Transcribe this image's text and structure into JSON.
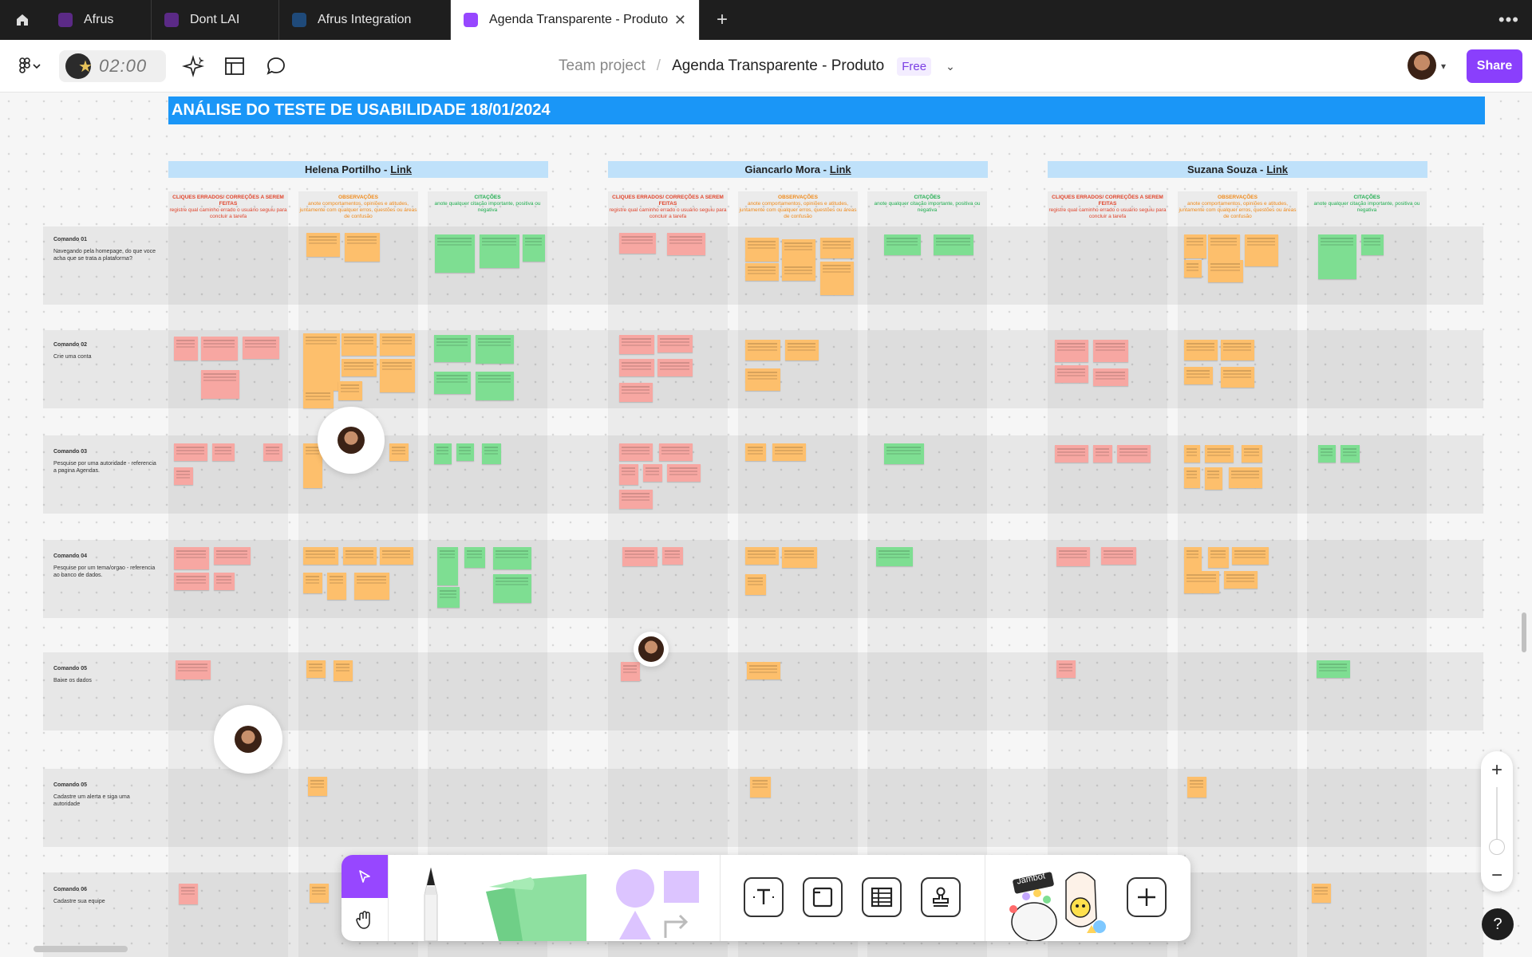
{
  "browser": {
    "tabs": [
      {
        "label": "Afrus"
      },
      {
        "label": "Dont LAI"
      },
      {
        "label": "Afrus Integration"
      },
      {
        "label": "Agenda Transparente - Produto",
        "active": true
      }
    ]
  },
  "toolbar": {
    "timer": "02:00",
    "breadcrumb_team": "Team project",
    "breadcrumb_file": "Agenda Transparente - Produto",
    "plan_badge": "Free",
    "share_label": "Share"
  },
  "board": {
    "banner": "ANÁLISE DO TESTE DE USABILIDADE 18/01/2024",
    "participants": [
      {
        "name": "Helena Portilho -",
        "link": "Link"
      },
      {
        "name": "Giancarlo Mora -",
        "link": "Link"
      },
      {
        "name": "Suzana Souza -",
        "link": "Link"
      }
    ],
    "column_headers": [
      {
        "title": "CLIQUES ERRADOS/ CORREÇÕES A SEREM FEITAS",
        "desc": "registre qual caminho errado o usuário seguiu para concluir a tarefa",
        "color": "#e0432a"
      },
      {
        "title": "OBSERVAÇÕES",
        "desc": "anote comportamentos, opiniões e atitudes, juntamente com qualquer erros, questões ou áreas de confusão",
        "color": "#f08a1a"
      },
      {
        "title": "CITAÇÕES",
        "desc": "anote qualquer citação importante, positiva ou negativa",
        "color": "#1fae4f"
      }
    ],
    "commands": [
      {
        "title": "Comando 01",
        "desc": "Navegando pela homepage, do que voce acha que se trata a plataforma?"
      },
      {
        "title": "Comando 02",
        "desc": "Crie uma conta"
      },
      {
        "title": "Comando 03",
        "desc": "Pesquise por uma autoridade - referencia a pagina Agendas."
      },
      {
        "title": "Comando 04",
        "desc": "Pesquise por um tema/orgao - referencia ao banco de dados."
      },
      {
        "title": "Comando 05",
        "desc": "Baixe os dados"
      },
      {
        "title": "Comando 05",
        "desc": "Cadastre um alerta e siga uma autoridade"
      },
      {
        "title": "Comando 06",
        "desc": "Cadastre sua equipe"
      }
    ]
  },
  "bottom_tools": {
    "jambot_label": "Jambot"
  },
  "colors": {
    "banner": "#1a96f7",
    "person_header": "#bfe1fa",
    "sticky_red": "#f7a7a2",
    "sticky_orange": "#fdbf6c",
    "sticky_green": "#7ede92",
    "accent": "#8a3ffc"
  },
  "icons": [
    "home-icon",
    "figma-file-icon",
    "close-icon",
    "plus-icon",
    "more-icon",
    "figma-menu-icon",
    "ai-sparkle-icon",
    "layout-icon",
    "comment-icon",
    "chevron-down-icon",
    "move-cursor-icon",
    "hand-icon",
    "marker-icon",
    "sticky-icon",
    "shapes-icon",
    "text-icon",
    "section-icon",
    "table-icon",
    "stamp-icon",
    "help-icon"
  ]
}
